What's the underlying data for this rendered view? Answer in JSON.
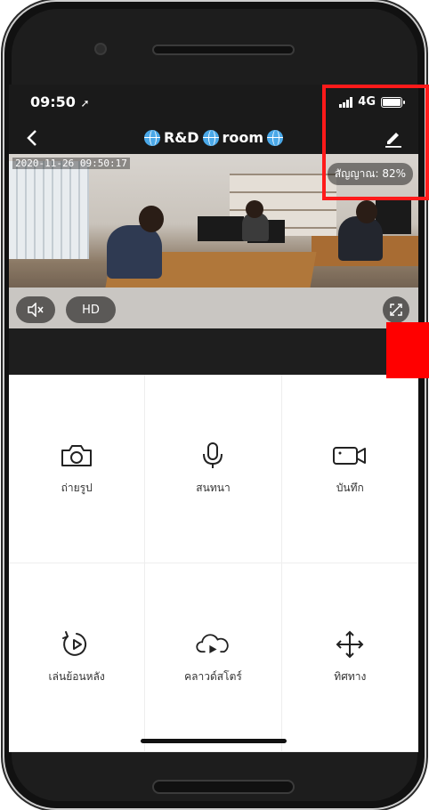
{
  "status_bar": {
    "time": "09:50",
    "network": "4G"
  },
  "nav": {
    "title": "R&D",
    "title_word": "room"
  },
  "video": {
    "timestamp": "2020-11-26 09:50:17",
    "signal_text": "สัญญาณ: 82%",
    "quality_label": "HD"
  },
  "actions": [
    {
      "label": "ถ่ายรูป",
      "icon": "camera-icon"
    },
    {
      "label": "สนทนา",
      "icon": "microphone-icon"
    },
    {
      "label": "บันทึก",
      "icon": "video-record-icon"
    },
    {
      "label": "เล่นย้อนหลัง",
      "icon": "playback-icon"
    },
    {
      "label": "คลาวด์สโตร์",
      "icon": "cloud-store-icon"
    },
    {
      "label": "ทิศทาง",
      "icon": "direction-arrows-icon"
    }
  ],
  "colors": {
    "highlight": "#ff1a1a",
    "globe": "#4aa8e8"
  }
}
